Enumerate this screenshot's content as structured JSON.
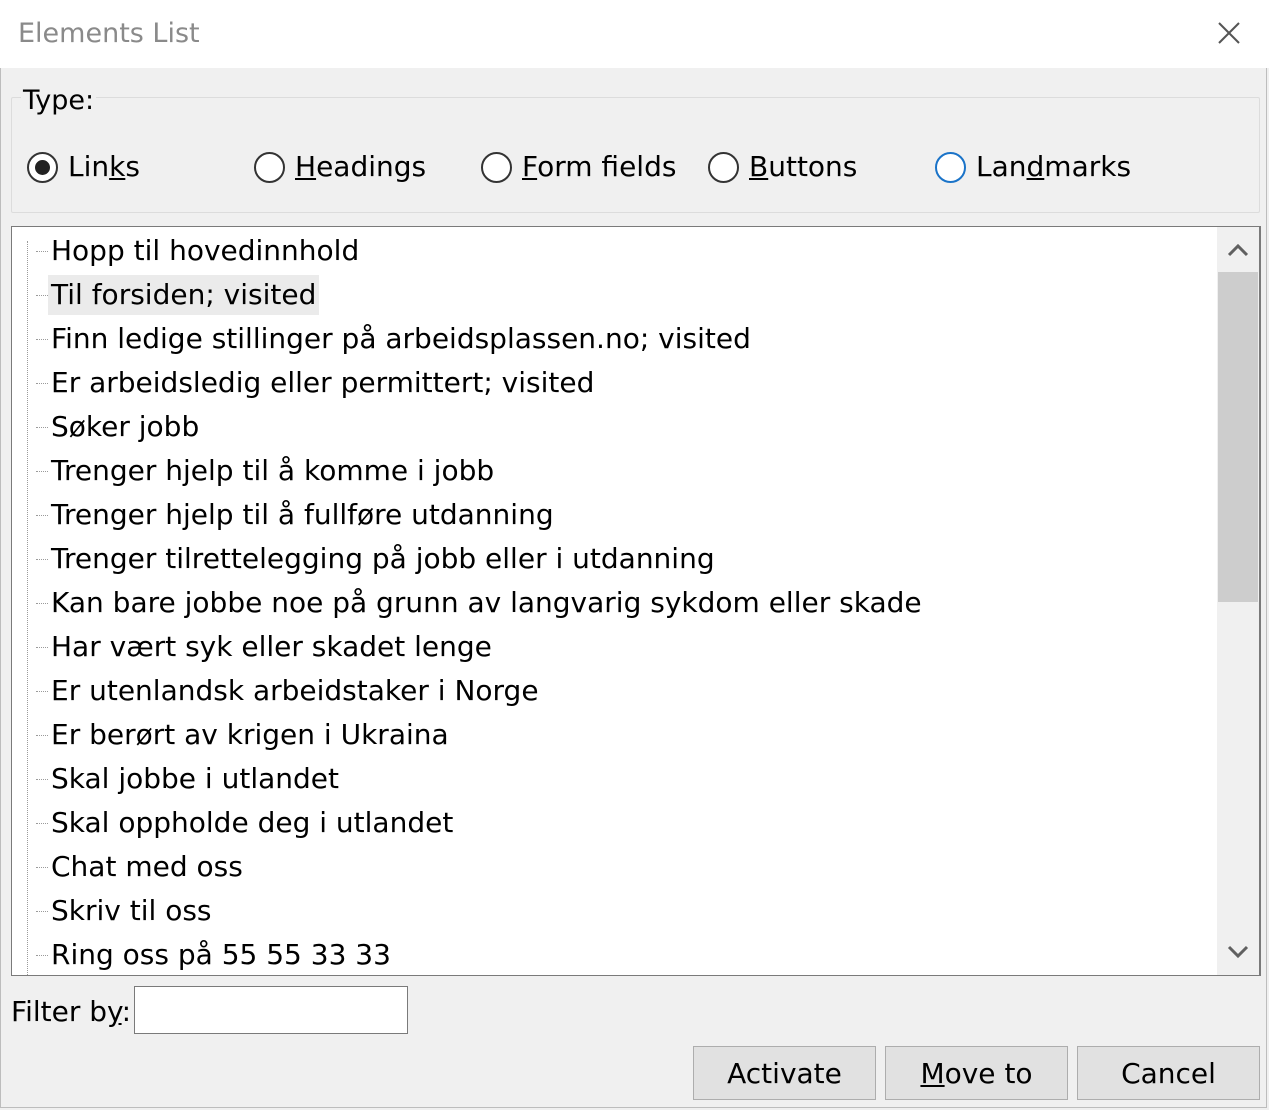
{
  "window": {
    "title": "Elements List"
  },
  "type_group": {
    "label": "Type:",
    "options": [
      {
        "pre": "Lin",
        "accel": "k",
        "post": "s",
        "selected": true,
        "focused": false
      },
      {
        "pre": "",
        "accel": "H",
        "post": "eadings",
        "selected": false,
        "focused": false
      },
      {
        "pre": "",
        "accel": "F",
        "post": "orm fields",
        "selected": false,
        "focused": false
      },
      {
        "pre": "",
        "accel": "B",
        "post": "uttons",
        "selected": false,
        "focused": false
      },
      {
        "pre": "Lan",
        "accel": "d",
        "post": "marks",
        "selected": false,
        "focused": true
      }
    ]
  },
  "list": {
    "selected_index": 1,
    "items": [
      "Hopp til hovedinnhold",
      "Til forsiden; visited",
      "Finn ledige stillinger på arbeidsplassen.no; visited",
      "Er arbeidsledig eller permittert; visited",
      "Søker jobb",
      "Trenger hjelp til å komme i jobb",
      "Trenger hjelp til å fullføre utdanning",
      "Trenger tilrettelegging på jobb eller i utdanning",
      "Kan bare jobbe noe på grunn av langvarig sykdom eller skade",
      "Har vært syk eller skadet lenge",
      "Er utenlandsk arbeidstaker i Norge",
      "Er berørt av krigen i Ukraina",
      "Skal jobbe i utlandet",
      "Skal oppholde deg i utlandet",
      "Chat med oss",
      "Skriv til oss",
      "Ring oss på 55 55 33 33"
    ]
  },
  "filter": {
    "label_pre": "Filter b",
    "label_accel": "y",
    "label_post": ":",
    "value": ""
  },
  "buttons": {
    "activate": "Activate",
    "move_to_accel": "M",
    "move_to_rest": "ove to",
    "cancel": "Cancel"
  },
  "colors": {
    "focus_ring": "#1a73c8",
    "selected_bg": "#ebebeb",
    "thumb": "#cdcdcd"
  },
  "icons": {
    "close": "close-icon",
    "up": "chevron-up-icon",
    "down": "chevron-down-icon"
  }
}
